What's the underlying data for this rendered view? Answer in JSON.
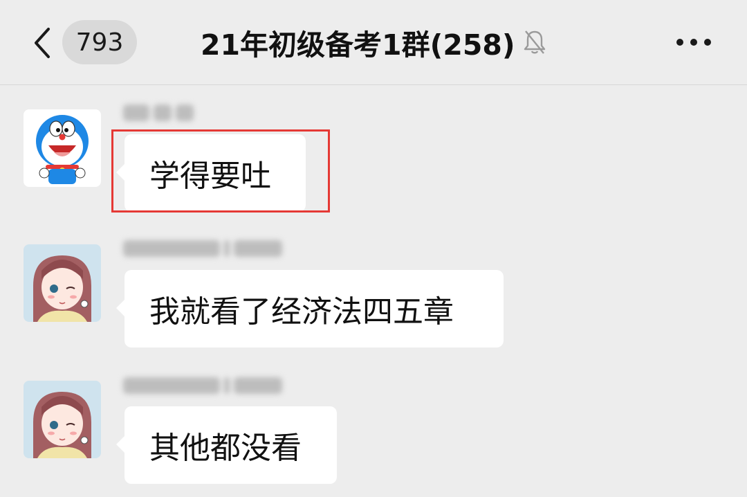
{
  "header": {
    "back_label": "<",
    "unread_count": "793",
    "chat_title": "21年初级备考1群(258)",
    "muted_icon": "bell-muted-icon",
    "more_icon": "more-dots-icon"
  },
  "messages": [
    {
      "avatar": "doraemon-avatar",
      "text": "学得要吐",
      "highlighted": true
    },
    {
      "avatar": "anime-girl-avatar",
      "text": "我就看了经济法四五章",
      "highlighted": false
    },
    {
      "avatar": "anime-girl-avatar",
      "text": "其他都没看",
      "highlighted": false
    }
  ],
  "colors": {
    "background": "#ededed",
    "bubble": "#ffffff",
    "highlight_border": "#e53935"
  }
}
